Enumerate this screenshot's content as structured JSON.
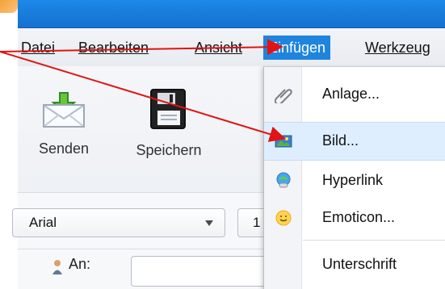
{
  "menu": {
    "items": [
      {
        "label": "Datei"
      },
      {
        "label": "Bearbeiten"
      },
      {
        "label": "Ansicht"
      },
      {
        "label": "Einfügen"
      },
      {
        "label": "Werkzeug"
      }
    ],
    "active_index": 3
  },
  "toolbar": {
    "send_label": "Senden",
    "save_label": "Speichern",
    "send_icon": "mail-send-icon",
    "save_icon": "floppy-disk-icon"
  },
  "format": {
    "font_value": "Arial",
    "size_value": "1"
  },
  "recipient": {
    "label": "An:",
    "icon": "person-icon"
  },
  "insert_menu": {
    "items": [
      {
        "label": "Anlage...",
        "icon": "paperclip-icon"
      },
      {
        "label": "Bild...",
        "icon": "image-icon"
      },
      {
        "label": "Hyperlink",
        "icon": "globe-link-icon"
      },
      {
        "label": "Emoticon...",
        "icon": "smiley-icon"
      },
      {
        "label": "Unterschrift",
        "icon": ""
      }
    ],
    "highlighted_index": 1
  },
  "colors": {
    "title_blue": "#1c88e8",
    "menu_highlight": "#1f84de",
    "arrow_red": "#e01414",
    "accent_orange": "#f6a23a"
  }
}
